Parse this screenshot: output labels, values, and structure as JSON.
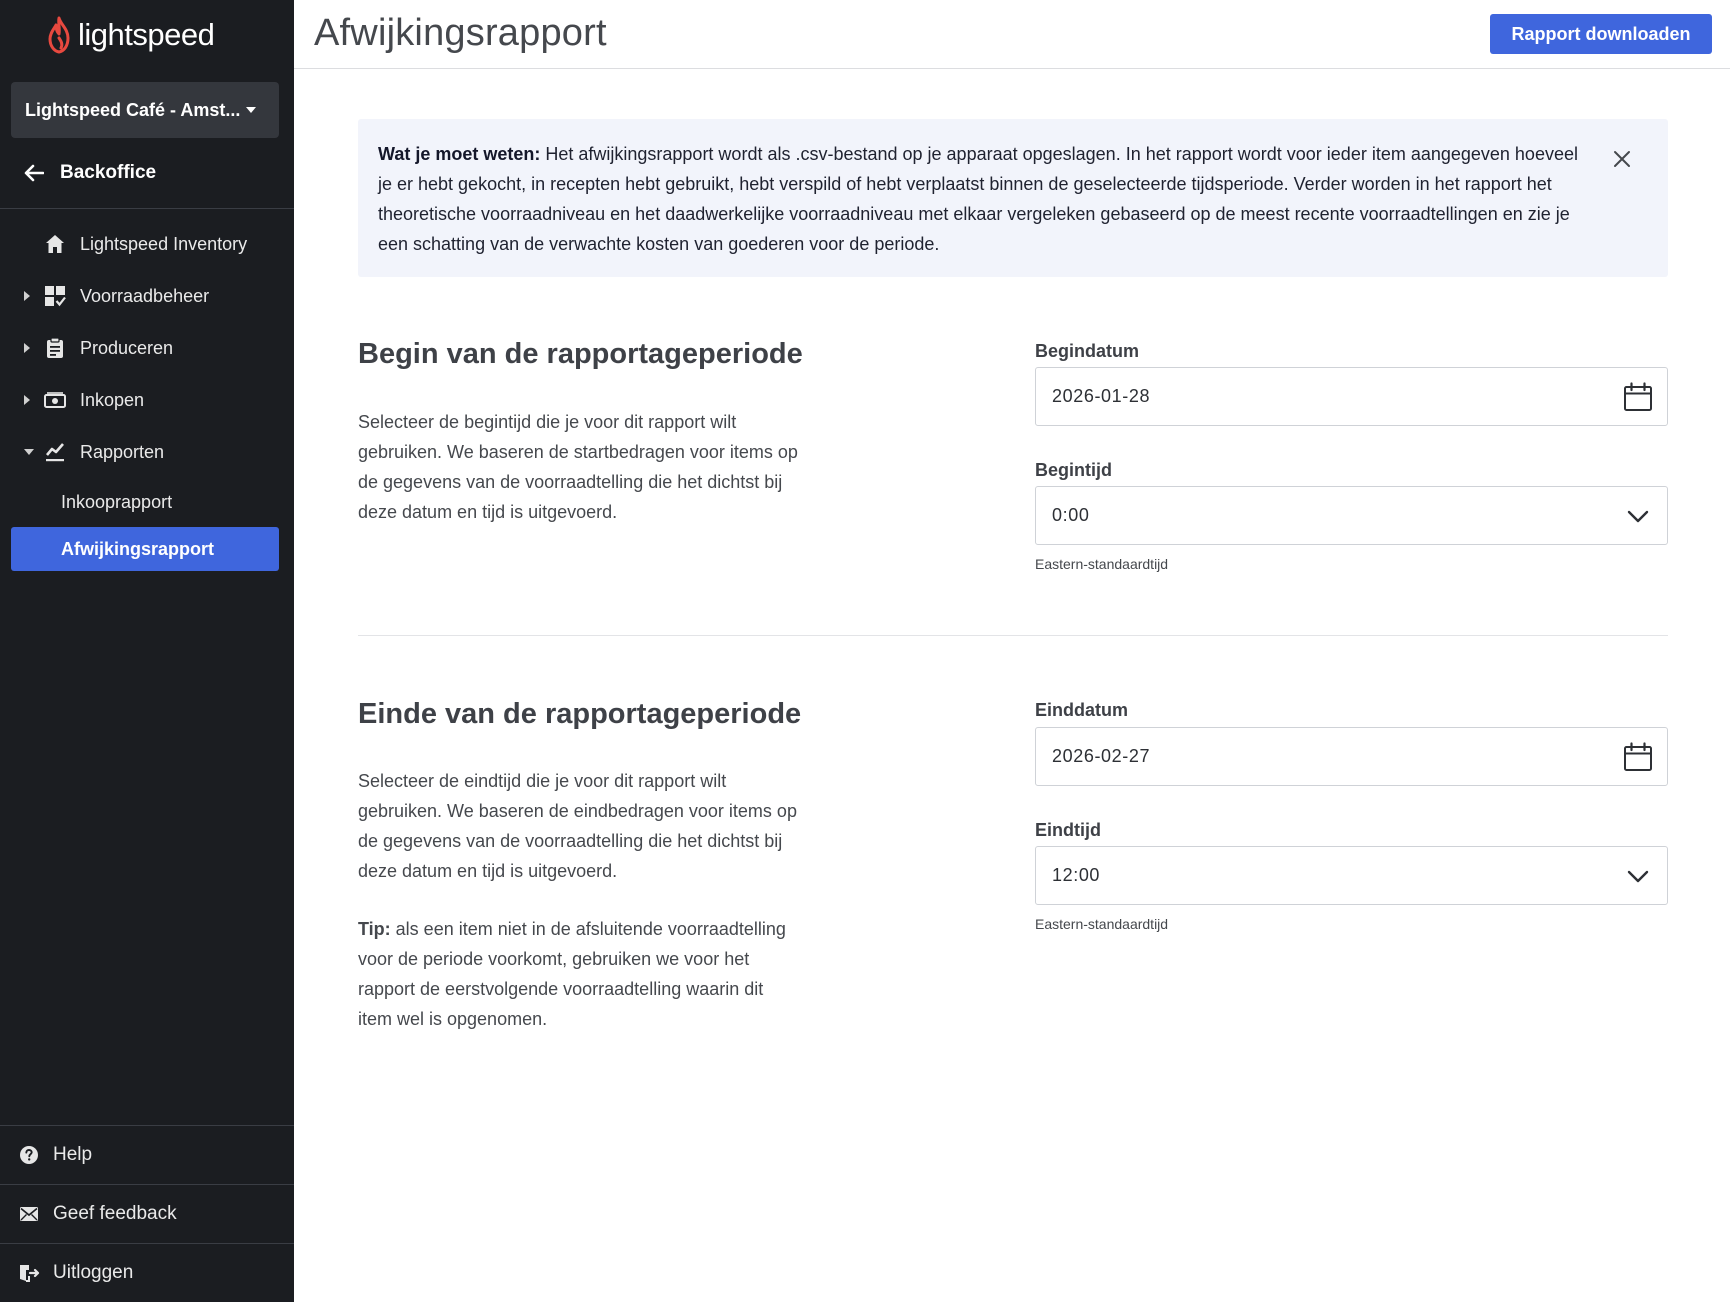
{
  "sidebar": {
    "logo_text": "lightspeed",
    "location": "Lightspeed Café - Amst...",
    "back_label": "Backoffice",
    "nav": [
      {
        "label": "Lightspeed Inventory",
        "icon": "home-icon"
      },
      {
        "label": "Voorraadbeheer",
        "icon": "inventory-grid-icon"
      },
      {
        "label": "Produceren",
        "icon": "clipboard-icon"
      },
      {
        "label": "Inkopen",
        "icon": "cash-icon"
      },
      {
        "label": "Rapporten",
        "icon": "chart-line-icon"
      }
    ],
    "sub_items": [
      {
        "label": "Inkooprapport",
        "active": false
      },
      {
        "label": "Afwijkingsrapport",
        "active": true
      }
    ],
    "footer": [
      {
        "label": "Help",
        "icon": "help-icon"
      },
      {
        "label": "Geef feedback",
        "icon": "mail-icon"
      },
      {
        "label": "Uitloggen",
        "icon": "logout-icon"
      }
    ],
    "accent_color": "#3f66dd",
    "background_color": "#1b1d21"
  },
  "header": {
    "title": "Afwijkingsrapport",
    "download_button": "Rapport downloaden"
  },
  "info_box": {
    "bold_prefix": "Wat je moet weten:",
    "text": " Het afwijkingsrapport wordt als .csv-bestand op je apparaat opgeslagen. In het rapport wordt voor ieder item aangegeven hoeveel je er hebt gekocht, in recepten hebt gebruikt, hebt verspild of hebt verplaatst binnen de geselecteerde tijdsperiode. Verder worden in het rapport het theoretische voorraadniveau en het daadwerkelijke voorraadniveau met elkaar vergeleken gebaseerd op de meest recente voorraadtellingen en zie je een schatting van de verwachte kosten van goederen voor de periode."
  },
  "start_section": {
    "title": "Begin van de rapportageperiode",
    "description": "Selecteer de begintijd die je voor dit rapport wilt gebruiken. We baseren de startbedragen voor items op de gegevens van de voorraadtelling die het dichtst bij deze datum en tijd is uitgevoerd.",
    "date_label": "Begindatum",
    "date_value": "2026-01-28",
    "time_label": "Begintijd",
    "time_value": "0:00",
    "timezone": "Eastern-standaardtijd"
  },
  "end_section": {
    "title": "Einde van de rapportageperiode",
    "description": "Selecteer de eindtijd die je voor dit rapport wilt gebruiken. We baseren de eindbedragen voor items op de gegevens van de voorraadtelling die het dichtst bij deze datum en tijd is uitgevoerd.",
    "tip_label": "Tip:",
    "tip_text": " als een item niet in de afsluitende voorraadtelling voor de periode voorkomt, gebruiken we voor het rapport de eerstvolgende voorraadtelling waarin dit item wel is opgenomen.",
    "date_label": "Einddatum",
    "date_value": "2026-02-27",
    "time_label": "Eindtijd",
    "time_value": "12:00",
    "timezone": "Eastern-standaardtijd"
  }
}
